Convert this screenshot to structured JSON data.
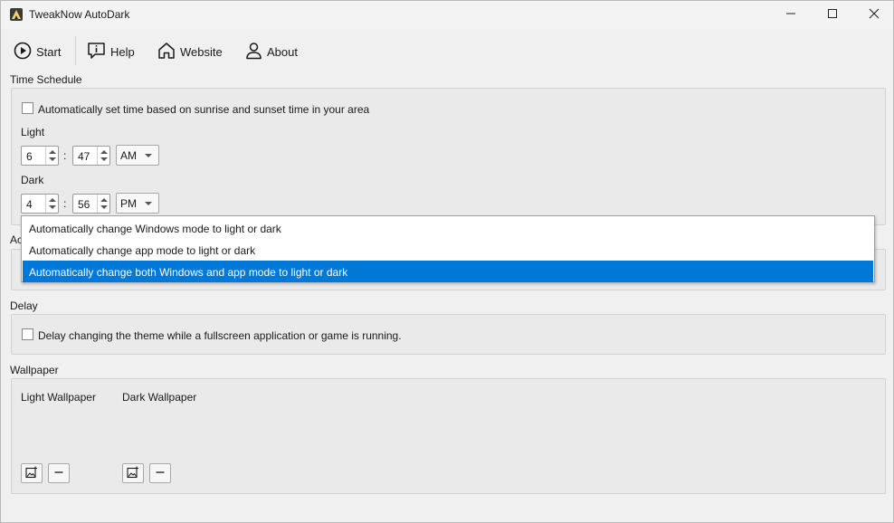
{
  "window": {
    "title": "TweakNow AutoDark"
  },
  "toolbar": {
    "start_label": "Start",
    "help_label": "Help",
    "website_label": "Website",
    "about_label": "About"
  },
  "time_schedule": {
    "heading": "Time Schedule",
    "auto_checkbox_label": "Automatically set time based on sunrise and sunset time in your area",
    "auto_checked": false,
    "light_label": "Light",
    "light_hour": "6",
    "light_minute": "47",
    "light_ampm": "AM",
    "dark_label": "Dark",
    "dark_hour": "4",
    "dark_minute": "56",
    "dark_ampm": "PM",
    "colon": ":"
  },
  "action": {
    "heading_partial": "Ac",
    "options": [
      "Automatically change Windows mode to light or dark",
      "Automatically change app mode to light or dark",
      "Automatically change both Windows and app mode to light or dark"
    ],
    "selected_index": 2
  },
  "delay": {
    "heading": "Delay",
    "checkbox_label": "Delay changing the theme while a fullscreen application or game is running.",
    "checked": false
  },
  "wallpaper": {
    "heading": "Wallpaper",
    "light_label": "Light Wallpaper",
    "dark_label": "Dark Wallpaper"
  },
  "colors": {
    "selection": "#0078d7",
    "background": "#f0f0f0",
    "group_bg": "#eaeaea"
  }
}
